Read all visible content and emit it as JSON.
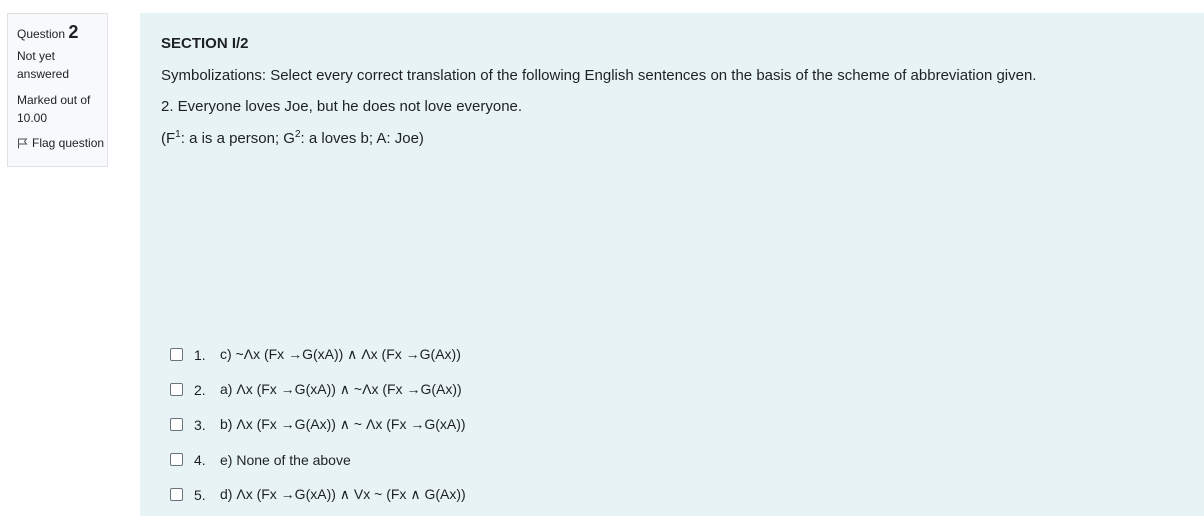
{
  "question_info": {
    "question_label": "Question",
    "question_number": "2",
    "state_line1": "Not yet",
    "state_line2": "answered",
    "grade_line1": "Marked out of",
    "grade_line2": "10.00",
    "flag_label": "Flag question",
    "flag_icon": "flag-outline-icon"
  },
  "question": {
    "section_title": "SECTION I/2",
    "instruction": "Symbolizations: Select every correct translation of the following English sentences on the basis of the scheme of abbreviation given.",
    "sentence": "2. Everyone loves Joe, but he does not love everyone.",
    "scheme": {
      "open": "(F",
      "f_sup": "1",
      "mid": ": a is a person; G",
      "g_sup": "2",
      "rest": ": a loves b; A: Joe)"
    }
  },
  "answers": [
    {
      "number": "1.",
      "text": "c)  ~Λx (Fx →G(xA)) ∧ Λx (Fx →G(Ax))",
      "checked": false
    },
    {
      "number": "2.",
      "text": "a)  Λx (Fx →G(xA)) ∧ ~Λx (Fx →G(Ax))",
      "checked": false
    },
    {
      "number": "3.",
      "text": "b)  Λx (Fx →G(Ax)) ∧ ~ Λx (Fx →G(xA))",
      "checked": false
    },
    {
      "number": "4.",
      "text": "e) None of the above",
      "checked": false
    },
    {
      "number": "5.",
      "text": "d) Λx (Fx →G(xA)) ∧ Vx ~ (Fx ∧ G(Ax))",
      "checked": false
    }
  ],
  "colors": {
    "content_background": "#e7f3f5",
    "info_background": "#f8f9fa"
  }
}
